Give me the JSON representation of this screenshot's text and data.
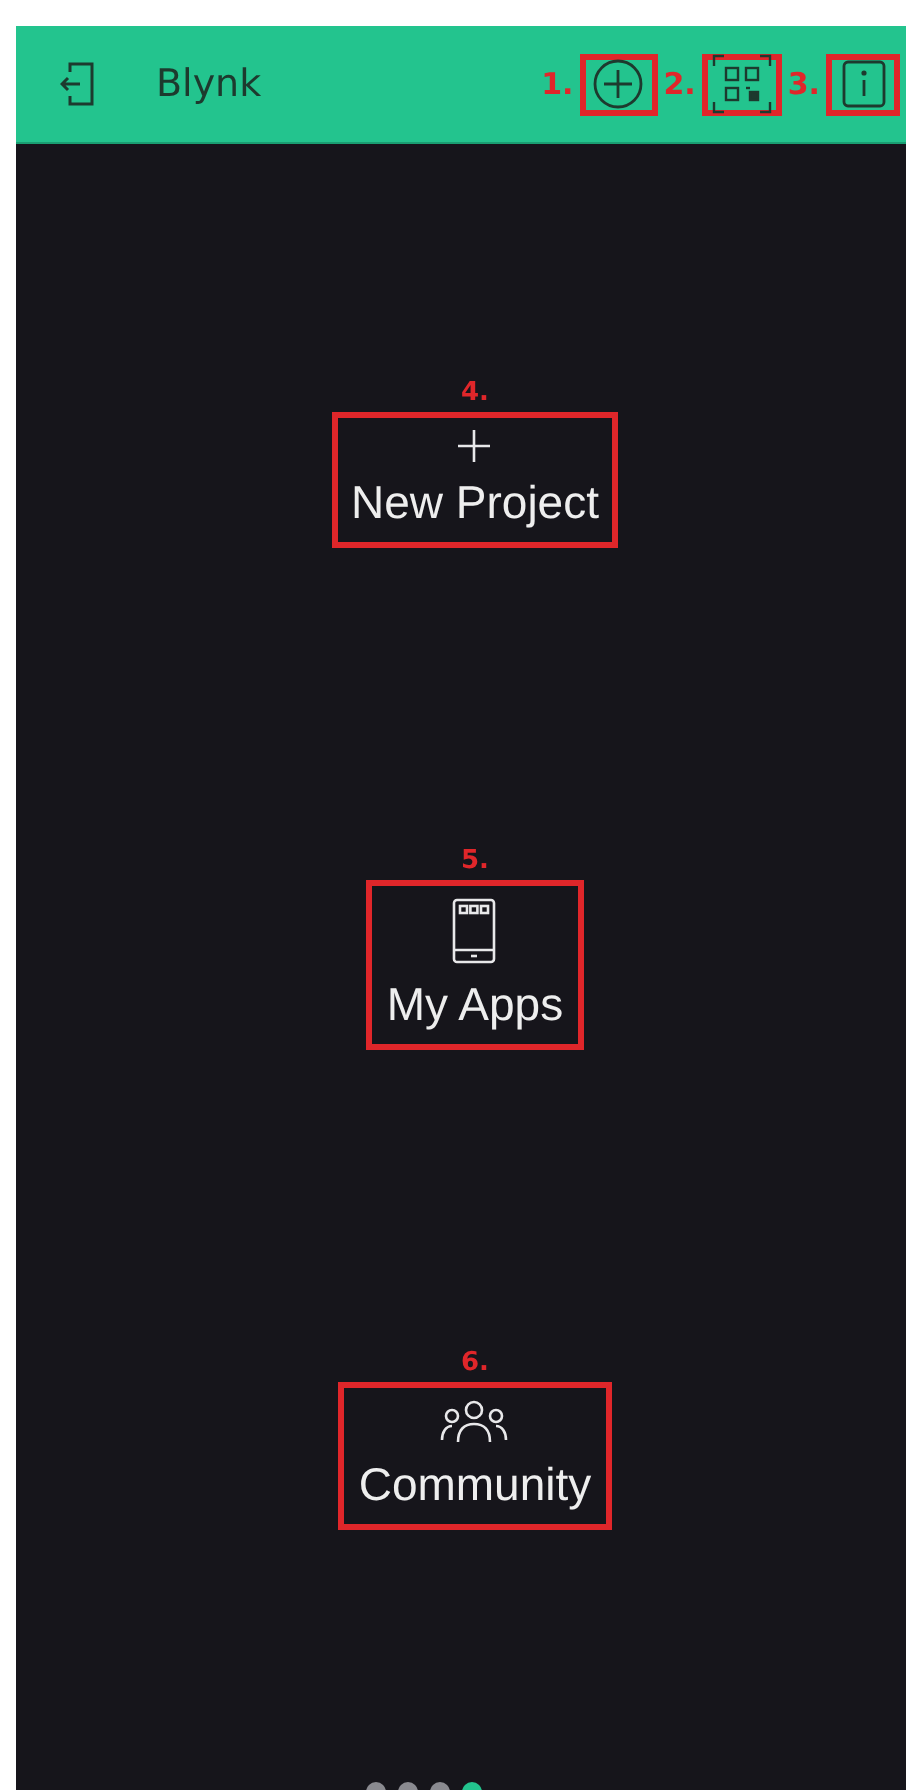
{
  "header": {
    "title": "Blynk",
    "actions": [
      {
        "kind": "add",
        "annotation": "1."
      },
      {
        "kind": "qr",
        "annotation": "2."
      },
      {
        "kind": "info",
        "annotation": "3."
      }
    ]
  },
  "menu": [
    {
      "kind": "plus",
      "label": "New Project",
      "annotation": "4."
    },
    {
      "kind": "phone",
      "label": "My Apps",
      "annotation": "5."
    },
    {
      "kind": "people",
      "label": "Community",
      "annotation": "6."
    }
  ],
  "pager": [
    {
      "selected": false
    },
    {
      "selected": false
    },
    {
      "selected": false
    },
    {
      "selected": true
    }
  ]
}
